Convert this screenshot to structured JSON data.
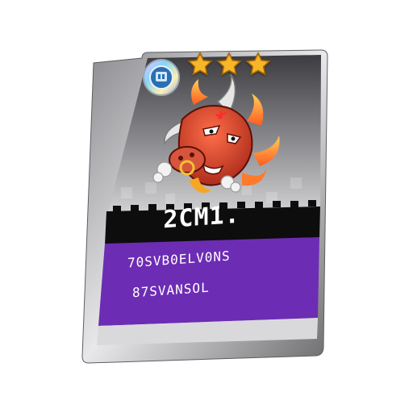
{
  "card": {
    "name": "2CM1.",
    "description_line1": "70SVB0ELV0NS",
    "description_line2": "87SVANSOL",
    "rarity_stars": 3,
    "emblem_icon": "badge-icon",
    "mascot_icon": "red-bull-mascot-icon",
    "colors": {
      "frame": "#4a4a4e",
      "top_gradient": "#9b9b9f",
      "title_band": "#0d0d0d",
      "info_panel": "#6d2cb4",
      "star": "#f7b52a",
      "bull": "#c83a24"
    }
  }
}
